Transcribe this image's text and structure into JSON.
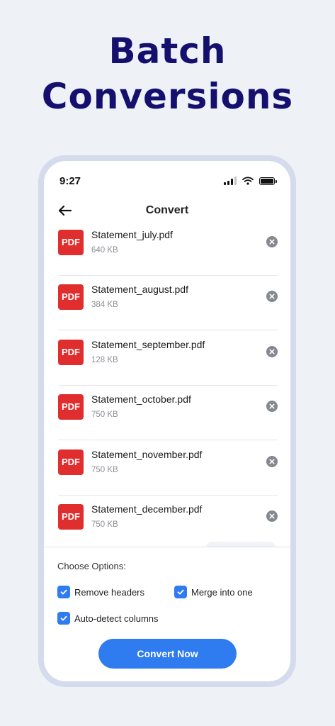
{
  "headline": {
    "line1": "Batch",
    "line2": "Conversions"
  },
  "status_bar": {
    "time": "9:27",
    "icons": [
      "cellular-signal-icon",
      "wifi-icon",
      "battery-icon"
    ]
  },
  "nav": {
    "title": "Convert",
    "back_icon": "arrow-left-icon"
  },
  "files": [
    {
      "badge": "PDF",
      "name": "Statement_july.pdf",
      "size": "640 KB"
    },
    {
      "badge": "PDF",
      "name": "Statement_august.pdf",
      "size": "384 KB"
    },
    {
      "badge": "PDF",
      "name": "Statement_september.pdf",
      "size": "128 KB"
    },
    {
      "badge": "PDF",
      "name": "Statement_october.pdf",
      "size": "750 KB"
    },
    {
      "badge": "PDF",
      "name": "Statement_november.pdf",
      "size": "750 KB"
    },
    {
      "badge": "PDF",
      "name": "Statement_december.pdf",
      "size": "750 KB"
    }
  ],
  "options": {
    "title": "Choose Options:",
    "items": [
      {
        "label": "Remove headers",
        "checked": true
      },
      {
        "label": "Merge into one",
        "checked": true
      },
      {
        "label": "Auto-detect columns",
        "checked": true
      }
    ]
  },
  "convert_button": {
    "label": "Convert Now"
  },
  "colors": {
    "background": "#eef1f6",
    "headline": "#150f6e",
    "accent": "#2f7bf0",
    "pdf_badge": "#e02d2d",
    "phone_frame": "#d4dbed"
  }
}
